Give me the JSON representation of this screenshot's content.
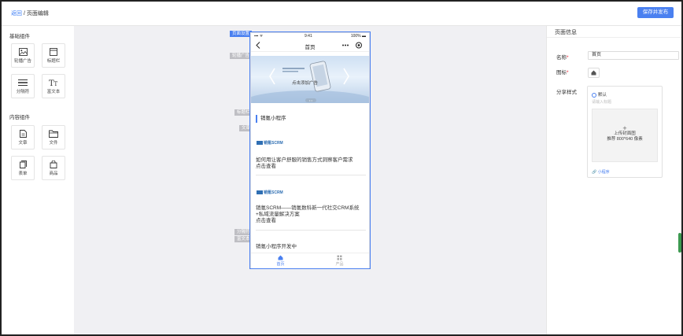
{
  "breadcrumb": {
    "back": "返回",
    "separator": " / ",
    "current": "页面编辑"
  },
  "toolbar": {
    "save_publish": "保存并发布"
  },
  "left_panel": {
    "basic_title": "基础组件",
    "basic_items": [
      {
        "label": "轮播广告",
        "icon": "image-icon"
      },
      {
        "label": "标题栏",
        "icon": "title-bar-icon"
      },
      {
        "label": "分隔符",
        "icon": "divider-icon"
      },
      {
        "label": "富文本",
        "icon": "rich-text-icon"
      }
    ],
    "content_title": "内容组件",
    "content_items": [
      {
        "label": "文章",
        "icon": "document-icon"
      },
      {
        "label": "文件",
        "icon": "folder-icon"
      },
      {
        "label": "表单",
        "icon": "form-icon"
      },
      {
        "label": "商品",
        "icon": "shopping-bag-icon"
      }
    ]
  },
  "canvas": {
    "tags": {
      "page_settings": "页面设置",
      "carousel": "轮播广告",
      "title_bar": "标题栏",
      "article": "文章",
      "divider": "分隔符",
      "rich_text": "富文本"
    },
    "phone": {
      "status_signal": "▪▪▪ ᯤ",
      "status_time": "9:41",
      "status_battery": "100% ▬",
      "nav_title": "首页",
      "banner_caption": "点击添加广告",
      "banner_dots": "• •",
      "section_title": "销氪小程序",
      "logo_text": "销氪SCRM",
      "articles": [
        {
          "title": "如何用让客户舒服的销售方式洞察客户需求",
          "link": "点击查看"
        },
        {
          "title": "销氪SCRM——销氪数科新一代社交CRM系统+私域流量解决方案",
          "link": "点击查看"
        }
      ],
      "rich_text": "销氪小程序开发中",
      "tabs": [
        {
          "label": "首页",
          "icon": "home-icon",
          "active": true
        },
        {
          "label": "产品",
          "icon": "grid-icon",
          "active": false
        }
      ]
    }
  },
  "right_panel": {
    "title": "页面信息",
    "name_label": "名称",
    "name_value": "首页",
    "icon_label": "图标",
    "share_label": "分享样式",
    "share_option": "默认",
    "share_placeholder": "请输入标题",
    "upload_line1": "上传封面图",
    "upload_line2": "推荐 800*640 像素",
    "mini_link": "小程序"
  },
  "colors": {
    "accent": "#4a80f0",
    "required": "#e23333",
    "scrollbar": "#3c9a50"
  }
}
